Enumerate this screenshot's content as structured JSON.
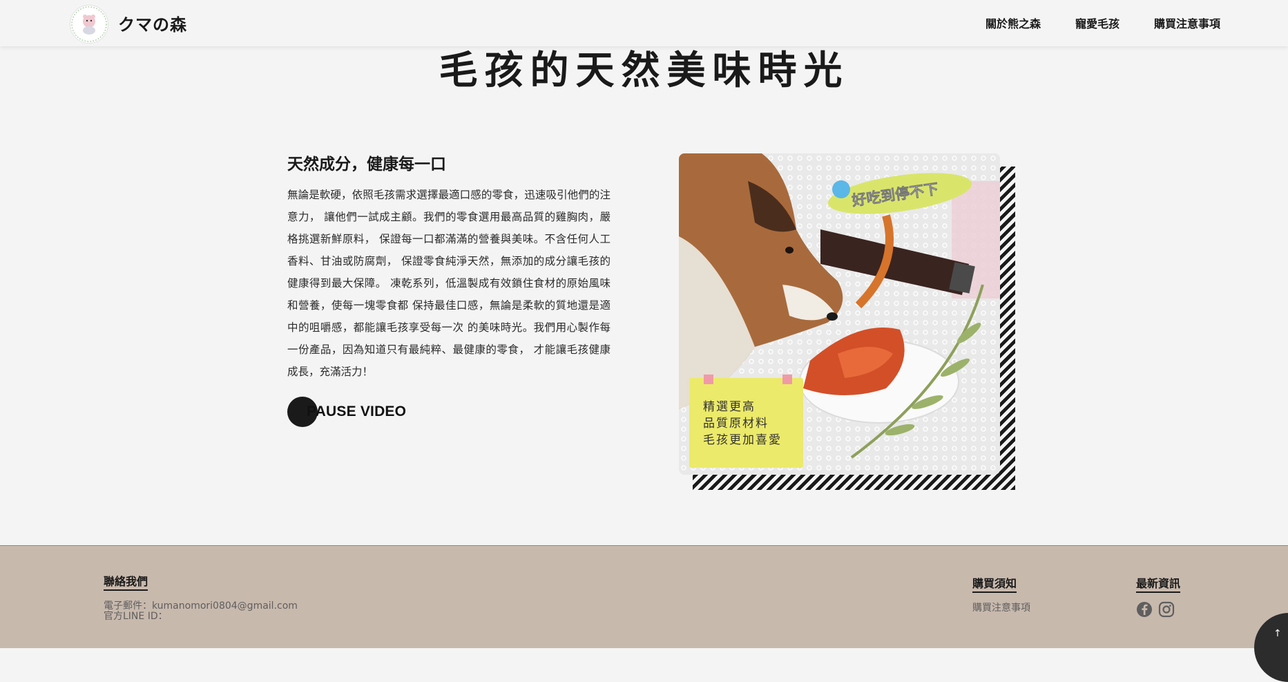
{
  "header": {
    "brand": "クマの森",
    "logo_icon": "bear-logo-icon",
    "nav": [
      "關於熊之森",
      "寵愛毛孩",
      "購買注意事項"
    ]
  },
  "hero": {
    "title": "毛孩的天然美味時光"
  },
  "section": {
    "subtitle": "天然成分，健康每一口",
    "body": "無論是軟硬，依照毛孩需求選擇最適口感的零食，迅速吸引他們的注意力， 讓他們一試成主顧。我們的零食選用最高品質的雞胸肉，嚴格挑選新鮮原料， 保證每一口都滿滿的營養與美味。不含任何人工香料、甘油或防腐劑， 保證零食純淨天然，無添加的成分讓毛孩的健康得到最大保障。 凍乾系列，低溫製成有效鎖住食材的原始風味和營養，使每一塊零食都 保持最佳口感，無論是柔軟的質地還是適中的咀嚼感，都能讓毛孩享受每一次 的美味時光。我們用心製作每一份產品，因為知道只有最純粹、最健康的零食， 才能讓毛孩健康成長，充滿活力！",
    "pause_label": "PAUSE VIDEO",
    "photo": {
      "sticker_top": "好吃到停不下",
      "note_lines": [
        "精選更高",
        "品質原材料",
        "毛孩更加喜愛"
      ]
    }
  },
  "footer": {
    "contact_title": "聯絡我們",
    "email": "電子郵件：kumanomori0804@gmail.com",
    "line_id": "官方LINE ID：",
    "purchase_title": "購買須知",
    "purchase_link": "購買注意事項",
    "news_title": "最新資訊",
    "social_icons": [
      "facebook-icon",
      "instagram-icon"
    ],
    "to_top_icon": "arrow-up-icon"
  },
  "colors": {
    "background": "#f4f4f4",
    "footer_bg": "#c8b9ad",
    "text": "#1a1a1a",
    "note_yellow": "#ecea6a"
  }
}
